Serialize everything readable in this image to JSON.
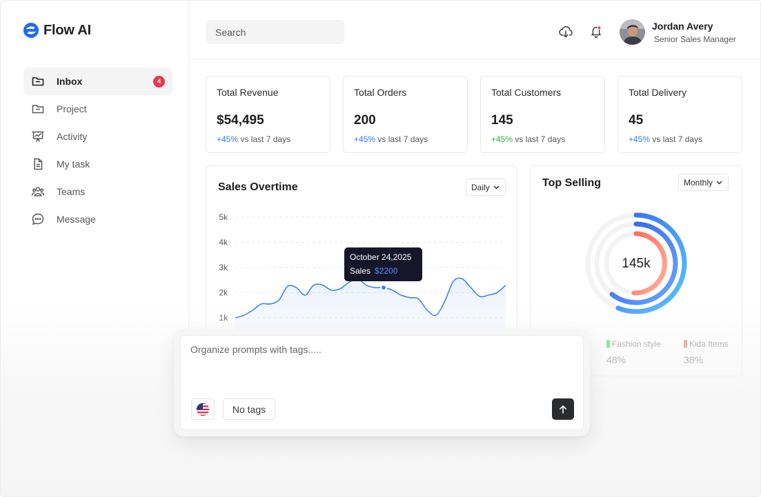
{
  "app": {
    "name": "Flow AI",
    "brand_color": "#1d6cf2"
  },
  "sidebar": {
    "items": [
      {
        "label": "Inbox",
        "icon": "inbox-folder-icon",
        "active": true,
        "badge": "4"
      },
      {
        "label": "Project",
        "icon": "folder-icon"
      },
      {
        "label": "Activity",
        "icon": "presentation-chart-icon"
      },
      {
        "label": "My task",
        "icon": "document-icon"
      },
      {
        "label": "Teams",
        "icon": "users-icon"
      },
      {
        "label": "Message",
        "icon": "chat-bubble-icon"
      }
    ]
  },
  "header": {
    "search_placeholder": "Search",
    "user": {
      "name": "Jordan Avery",
      "role": "Senior Sales Manager"
    }
  },
  "stats": [
    {
      "title": "Total Revenue",
      "value": "$54,495",
      "delta": "+45%",
      "delta_text": "vs last 7 days",
      "delta_color": "#2f7cf6"
    },
    {
      "title": "Total Orders",
      "value": "200",
      "delta": "+45%",
      "delta_text": "vs last 7 days",
      "delta_color": "#2f7cf6"
    },
    {
      "title": "Total Customers",
      "value": "145",
      "delta": "+45%",
      "delta_text": "vs last 7 days",
      "delta_color": "#2fb344"
    },
    {
      "title": "Total Delivery",
      "value": "45",
      "delta": "+45%",
      "delta_text": "vs last 7 days",
      "delta_color": "#2f7cf6"
    }
  ],
  "sales": {
    "title": "Sales Overtime",
    "period": "Daily",
    "tooltip": {
      "date": "October 24,2025",
      "label": "Sales",
      "value": "$2200"
    }
  },
  "top_selling": {
    "title": "Top Selling",
    "period": "Monthly",
    "center_value": "145k",
    "legend": [
      {
        "label": "Fashion style",
        "pct": "48%",
        "color": "#4cd964"
      },
      {
        "label": "Kida Items",
        "pct": "38%",
        "color": "#f7826c"
      }
    ]
  },
  "prompt": {
    "placeholder": "Organize prompts with tags.....",
    "tags_label": "No tags"
  },
  "chart_data": {
    "type": "line",
    "title": "Sales Overtime",
    "xlabel": "",
    "ylabel": "",
    "yticks": [
      "1k",
      "2k",
      "3k",
      "4k",
      "5k"
    ],
    "ylim": [
      1000,
      5000
    ],
    "grid": true,
    "series": [
      {
        "values": [
          1000,
          1100,
          1300,
          1550,
          1550,
          1700,
          2250,
          2200,
          1900,
          2300,
          2300,
          2100,
          2150,
          2400,
          2550,
          2300,
          2200,
          2200,
          2100,
          1900,
          1800,
          1750,
          1300,
          1100,
          1650,
          2450,
          2550,
          2200,
          1850,
          1900,
          2000,
          2300
        ]
      }
    ],
    "highlight": {
      "index": 17,
      "value": 2200
    }
  }
}
